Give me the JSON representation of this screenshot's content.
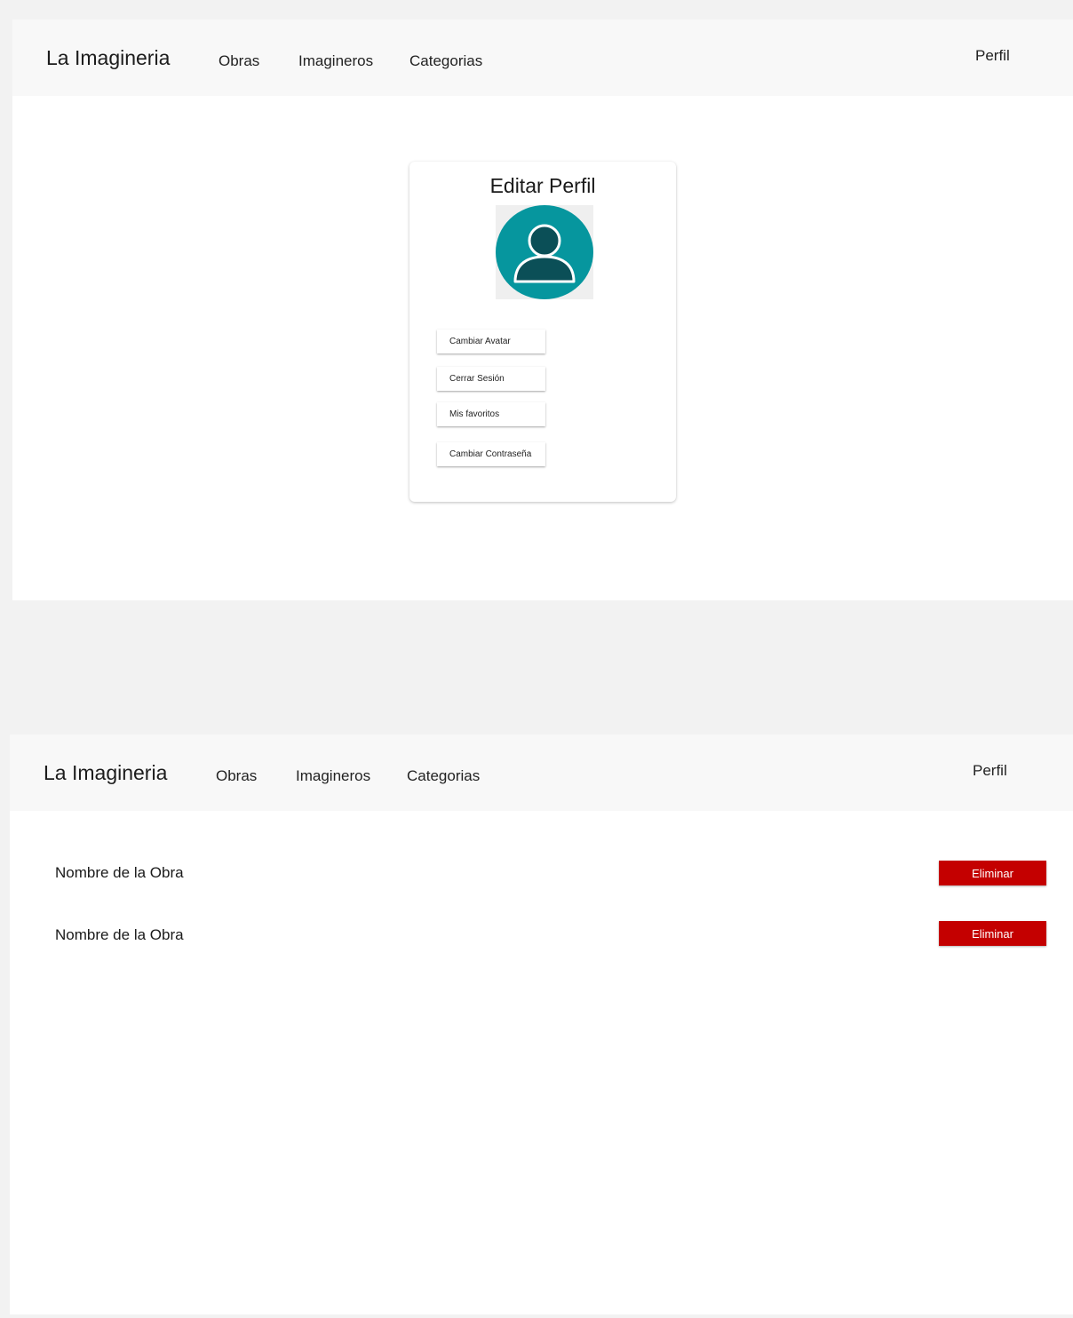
{
  "edit_screen": {
    "nav": {
      "brand": "La Imagineria",
      "links": [
        "Obras",
        "Imagineros",
        "Categorias"
      ],
      "profile": "Perfil"
    },
    "card": {
      "title": "Editar Perfil",
      "avatar_icon": "user-avatar-icon",
      "buttons": [
        "Cambiar Avatar",
        "Cerrar Sesión",
        "Mis favoritos",
        "Cambiar Contraseña"
      ]
    }
  },
  "favorites_screen": {
    "nav": {
      "brand": "La Imagineria",
      "links": [
        "Obras",
        "Imagineros",
        "Categorias"
      ],
      "profile": "Perfil"
    },
    "rows": [
      {
        "name": "Nombre de la Obra",
        "action": "Eliminar"
      },
      {
        "name": "Nombre de la Obra",
        "action": "Eliminar"
      }
    ]
  },
  "colors": {
    "accent_teal": "#06969e",
    "avatar_dark": "#0b4f57",
    "danger_red": "#c40000"
  }
}
